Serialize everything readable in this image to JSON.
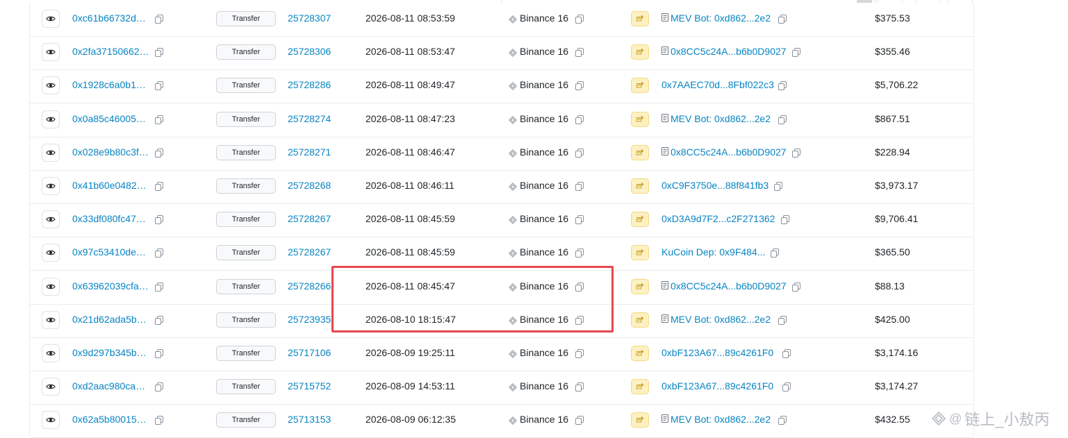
{
  "table": {
    "rows": [
      {
        "hash": "0xc61b66732d…",
        "method": "Transfer",
        "block": "25728307",
        "age": "2026-08-11 08:53:59",
        "from": "Binance 16",
        "to": "MEV Bot: 0xd862...2e2",
        "to_contract": true,
        "amount": "$375.53"
      },
      {
        "hash": "0x2fa37150662…",
        "method": "Transfer",
        "block": "25728306",
        "age": "2026-08-11 08:53:47",
        "from": "Binance 16",
        "to": "0x8CC5c24A...b6b0D9027",
        "to_contract": true,
        "amount": "$355.46"
      },
      {
        "hash": "0x1928c6a0b1…",
        "method": "Transfer",
        "block": "25728286",
        "age": "2026-08-11 08:49:47",
        "from": "Binance 16",
        "to": "0x7AAEC70d...8Fbf022c3",
        "to_contract": false,
        "amount": "$5,706.22"
      },
      {
        "hash": "0x0a85c46005…",
        "method": "Transfer",
        "block": "25728274",
        "age": "2026-08-11 08:47:23",
        "from": "Binance 16",
        "to": "MEV Bot: 0xd862...2e2",
        "to_contract": true,
        "amount": "$867.51"
      },
      {
        "hash": "0x028e9b80c3f…",
        "method": "Transfer",
        "block": "25728271",
        "age": "2026-08-11 08:46:47",
        "from": "Binance 16",
        "to": "0x8CC5c24A...b6b0D9027",
        "to_contract": true,
        "amount": "$228.94"
      },
      {
        "hash": "0x41b60e0482…",
        "method": "Transfer",
        "block": "25728268",
        "age": "2026-08-11 08:46:11",
        "from": "Binance 16",
        "to": "0xC9F3750e...88f841fb3",
        "to_contract": false,
        "amount": "$3,973.17"
      },
      {
        "hash": "0x33df080fc47…",
        "method": "Transfer",
        "block": "25728267",
        "age": "2026-08-11 08:45:59",
        "from": "Binance 16",
        "to": "0xD3A9d7F2...c2F271362",
        "to_contract": false,
        "amount": "$9,706.41"
      },
      {
        "hash": "0x97c53410de…",
        "method": "Transfer",
        "block": "25728267",
        "age": "2026-08-11 08:45:59",
        "from": "Binance 16",
        "to": "KuCoin Dep: 0x9F484...",
        "to_contract": false,
        "amount": "$365.50"
      },
      {
        "hash": "0x63962039cfa…",
        "method": "Transfer",
        "block": "25728266",
        "age": "2026-08-11 08:45:47",
        "from": "Binance 16",
        "to": "0x8CC5c24A...b6b0D9027",
        "to_contract": true,
        "amount": "$88.13"
      },
      {
        "hash": "0x21d62ada5b…",
        "method": "Transfer",
        "block": "25723935",
        "age": "2026-08-10 18:15:47",
        "from": "Binance 16",
        "to": "MEV Bot: 0xd862...2e2",
        "to_contract": true,
        "amount": "$425.00"
      },
      {
        "hash": "0x9d297b345b…",
        "method": "Transfer",
        "block": "25717106",
        "age": "2026-08-09 19:25:11",
        "from": "Binance 16",
        "to": "0xbF123A67...89c4261F0",
        "to_contract": false,
        "amount": "$3,174.16"
      },
      {
        "hash": "0xd2aac980ca…",
        "method": "Transfer",
        "block": "25715752",
        "age": "2026-08-09 14:53:11",
        "from": "Binance 16",
        "to": "0xbF123A67...89c4261F0",
        "to_contract": false,
        "amount": "$3,174.27"
      },
      {
        "hash": "0x62a5b80015…",
        "method": "Transfer",
        "block": "25713153",
        "age": "2026-08-09 06:12:35",
        "from": "Binance 16",
        "to": "MEV Bot: 0xd862...2e2",
        "to_contract": true,
        "amount": "$432.55"
      }
    ]
  },
  "watermark": {
    "at": "@",
    "text": "链上_小敖丙"
  },
  "colors": {
    "link": "#0784c3",
    "highlight": "#e5484d",
    "badge_bg": "#fdf1c4",
    "row_border": "#e9ecef"
  }
}
